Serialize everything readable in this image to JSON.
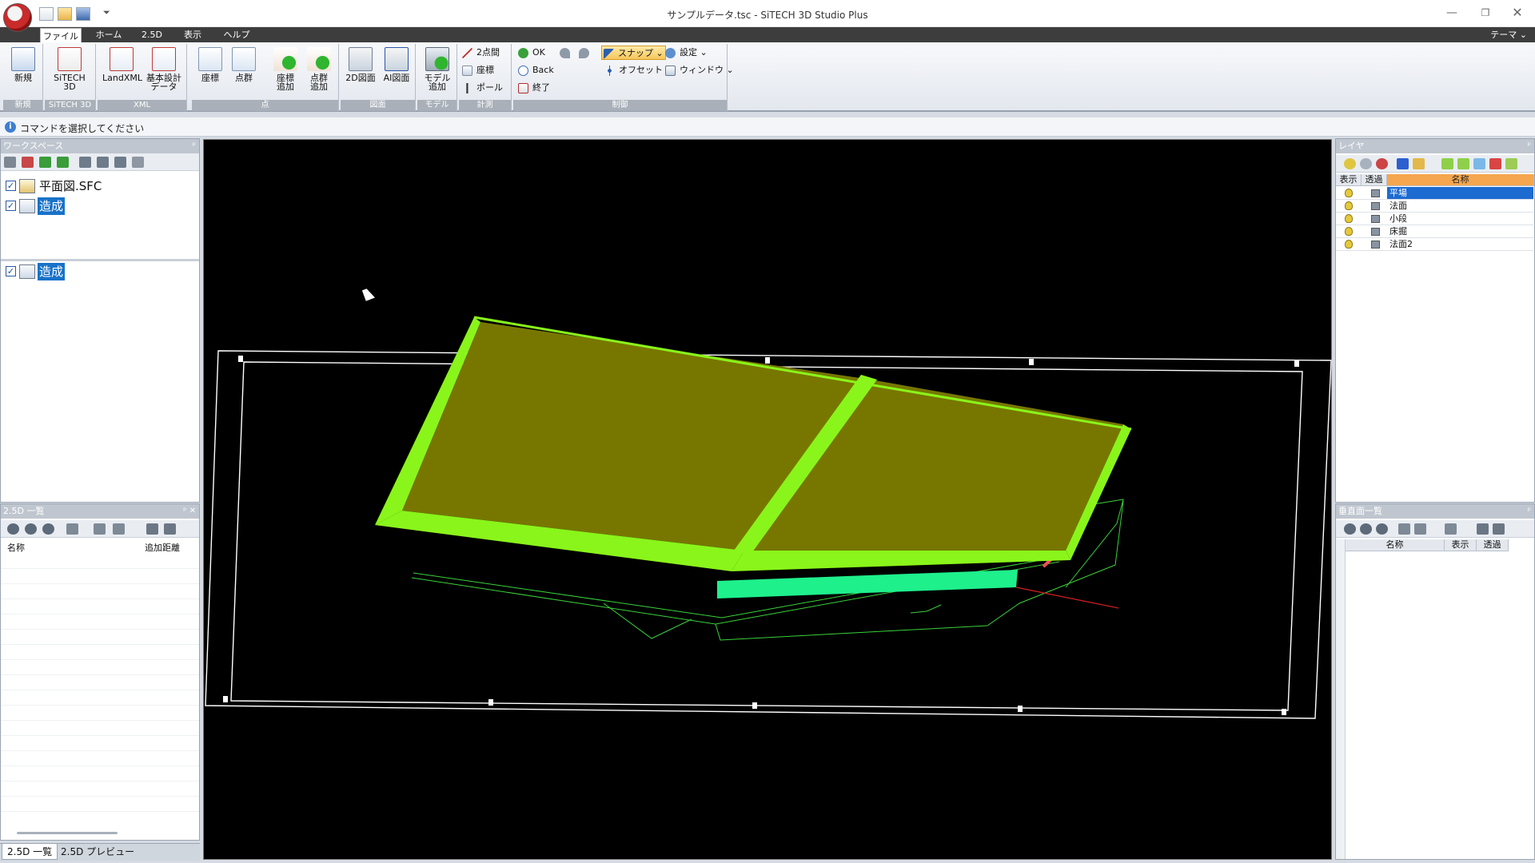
{
  "window": {
    "title": "サンプルデータ.tsc - SiTECH 3D Studio Plus",
    "minimize": "—",
    "maximize": "❐",
    "close": "✕"
  },
  "ribbon_tabs": [
    "ファイル",
    "ホーム",
    "2.5D",
    "表示",
    "ヘルプ"
  ],
  "theme_label": "テーマ ⌄",
  "qat_more": "⏷",
  "ribbon": {
    "groups": {
      "new": "新規",
      "sitech": "SiTECH 3D",
      "xml": "XML",
      "point": "点",
      "drawing": "図面",
      "model": "モデル",
      "measure": "計測",
      "control": "制御"
    },
    "buttons": {
      "new": "新規",
      "sitech3d": "SiTECH\n3D",
      "landxml": "LandXML",
      "basic_design": "基本設計\nデータ",
      "coord": "座標",
      "point_group": "点群",
      "add_coord": "座標\n追加",
      "add_point_group": "点群\n追加",
      "drawing_2d": "2D図面",
      "ai_drawing": "AI図面",
      "add_model": "モデル\n追加",
      "two_point": "2点間",
      "measure_coord": "座標",
      "pole": "ポール",
      "ok": "OK",
      "back": "Back",
      "end": "終了",
      "snap": "スナップ ⌄",
      "offset": "オフセット",
      "settings": "設定 ⌄",
      "window_menu": "ウィンドウ ⌄"
    }
  },
  "command_bar": {
    "info": "i",
    "text": "コマンドを選択してください"
  },
  "workspace": {
    "title": "ワークスペース",
    "pin": "ᵖ",
    "items": [
      {
        "label": "平面図.SFC",
        "checked": "✓"
      },
      {
        "label": "造成",
        "checked": "✓"
      }
    ],
    "lower_items": [
      {
        "label": "造成",
        "checked": "✓"
      }
    ]
  },
  "list25d": {
    "title": "2.5D 一覧",
    "pin": "ᵖ ✕",
    "columns": [
      "名称",
      "追加距離"
    ]
  },
  "bottom_tabs": [
    "2.5D 一覧",
    "2.5D プレビュー"
  ],
  "layers": {
    "title": "レイヤ",
    "pin": "ᵖ",
    "columns": [
      "表示",
      "透過",
      "名称"
    ],
    "rows": [
      {
        "name": "平場",
        "selected": true
      },
      {
        "name": "法面"
      },
      {
        "name": "小段"
      },
      {
        "name": "床掘"
      },
      {
        "name": "法面2"
      }
    ]
  },
  "vertical_list": {
    "title": "垂直面一覧",
    "pin": "ᵖ",
    "columns": [
      "名称",
      "表示",
      "透過"
    ]
  },
  "colors": {
    "model_green": "#8af51a",
    "model_fill": "#777700",
    "base_cyan": "#1ef08c",
    "grid_line": "#3ad23a",
    "accent_blue": "#1872c8"
  }
}
